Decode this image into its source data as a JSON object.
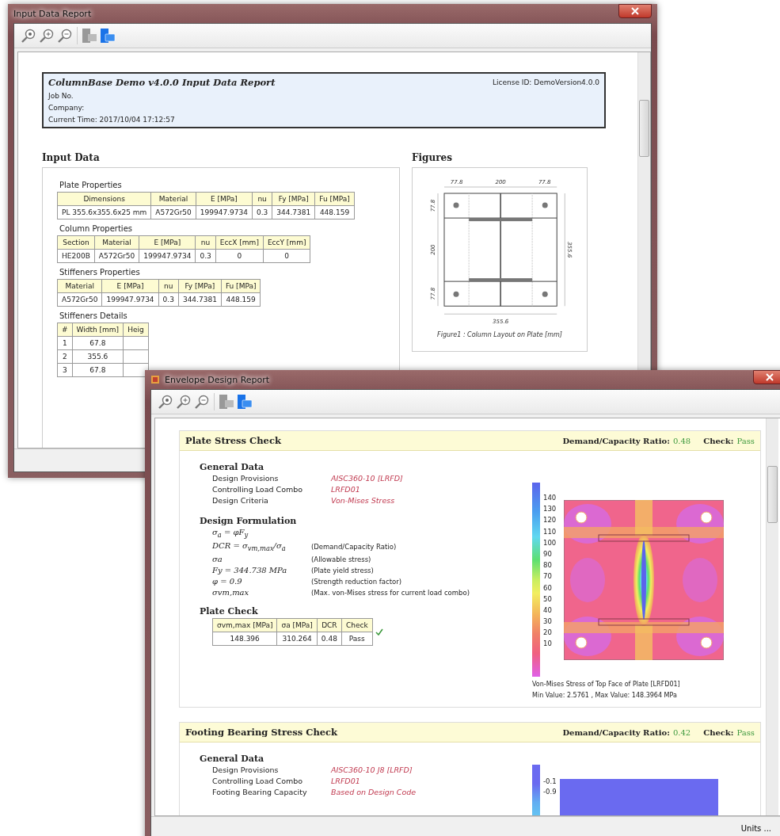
{
  "input_window": {
    "title": "Input Data Report",
    "report_header": {
      "title": "ColumnBase Demo v4.0.0 Input Data Report",
      "license": "License ID: DemoVersion4.0.0",
      "lines": [
        "Job No.",
        "Company:",
        "Current Time: 2017/10/04 17:12:57"
      ]
    },
    "input_data": {
      "heading": "Input Data",
      "tables": [
        {
          "title": "Plate Properties",
          "columns": [
            "Dimensions",
            "Material",
            "E [MPa]",
            "nu",
            "Fy [MPa]",
            "Fu [MPa]"
          ],
          "rows": [
            [
              "PL 355.6x355.6x25 mm",
              "A572Gr50",
              "199947.9734",
              "0.3",
              "344.7381",
              "448.159"
            ]
          ]
        },
        {
          "title": "Column Properties",
          "columns": [
            "Section",
            "Material",
            "E [MPa]",
            "nu",
            "EccX [mm]",
            "EccY [mm]"
          ],
          "rows": [
            [
              "HE200B",
              "A572Gr50",
              "199947.9734",
              "0.3",
              "0",
              "0"
            ]
          ]
        },
        {
          "title": "Stiffeners Properties",
          "columns": [
            "Material",
            "E [MPa]",
            "nu",
            "Fy [MPa]",
            "Fu [MPa]"
          ],
          "rows": [
            [
              "A572Gr50",
              "199947.9734",
              "0.3",
              "344.7381",
              "448.159"
            ]
          ]
        },
        {
          "title": "Stiffeners Details",
          "columns": [
            "#",
            "Width [mm]",
            "Heig"
          ],
          "rows": [
            [
              "1",
              "67.8"
            ],
            [
              "2",
              "355.6"
            ],
            [
              "3",
              "67.8"
            ]
          ]
        }
      ]
    },
    "figures": {
      "heading": "Figures",
      "top_dims": [
        "77.8",
        "200",
        "77.8"
      ],
      "left_dims": [
        "77.8",
        "200",
        "77.8"
      ],
      "right_dim": "355.6",
      "bottom_dim": "355.6",
      "caption": "Figure1 : Column Layout on Plate [mm]"
    }
  },
  "design_window": {
    "title": "Envelope Design Report",
    "sections": [
      {
        "title": "Plate Stress Check",
        "ratio_label": "Demand/Capacity Ratio:",
        "ratio": "0.48",
        "check_label": "Check:",
        "check": "Pass",
        "general_heading": "General Data",
        "general": [
          {
            "label": "Design Provisions",
            "value": "AISC360-10 [LRFD]"
          },
          {
            "label": "Controlling Load Combo",
            "value": "LRFD01"
          },
          {
            "label": "Design Criteria",
            "value": "Von-Mises Stress"
          }
        ],
        "formulation_heading": "Design Formulation",
        "formulas": [
          {
            "expr": "σ$_{a}$ = φF$_{y}$"
          },
          {
            "expr": "DCR = σ$_{vm,max}$/σ$_{a}$",
            "note": "(Demand/Capacity Ratio)"
          },
          {
            "expr": "σa",
            "note": "(Allowable stress)"
          },
          {
            "expr": "Fy = 344.738 MPa",
            "note": "(Plate yield stress)"
          },
          {
            "expr": "φ = 0.9",
            "note": "(Strength reduction factor)"
          },
          {
            "expr": "σvm,max",
            "note": "(Max. von-Mises stress for current load combo)"
          }
        ],
        "check_heading": "Plate Check",
        "check_table": {
          "columns": [
            "σvm,max [MPa]",
            "σa [MPa]",
            "DCR",
            "Check"
          ],
          "rows": [
            [
              "148.396",
              "310.264",
              "0.48",
              "Pass"
            ]
          ]
        },
        "contour": {
          "kind": "plate",
          "legend": [
            "140",
            "130",
            "120",
            "110",
            "100",
            "90",
            "80",
            "70",
            "60",
            "50",
            "40",
            "30",
            "20",
            "10"
          ],
          "caption": [
            "Von-Mises Stress of Top Face of Plate [LRFD01]",
            "Min Value: 2.5761 , Max Value: 148.3964 MPa"
          ]
        }
      },
      {
        "title": "Footing Bearing Stress Check",
        "ratio_label": "Demand/Capacity Ratio:",
        "ratio": "0.42",
        "check_label": "Check:",
        "check": "Pass",
        "general_heading": "General Data",
        "general": [
          {
            "label": "Design Provisions",
            "value": "AISC360-10 J8 [LRFD]"
          },
          {
            "label": "Controlling Load Combo",
            "value": "LRFD01"
          },
          {
            "label": "Footing Bearing Capacity",
            "value": "Based on Design Code"
          }
        ],
        "contour": {
          "kind": "bearing",
          "legend": [
            "-0.1",
            "-0.9"
          ]
        }
      }
    ],
    "status_bar": {
      "units_button": "Units ..."
    }
  }
}
